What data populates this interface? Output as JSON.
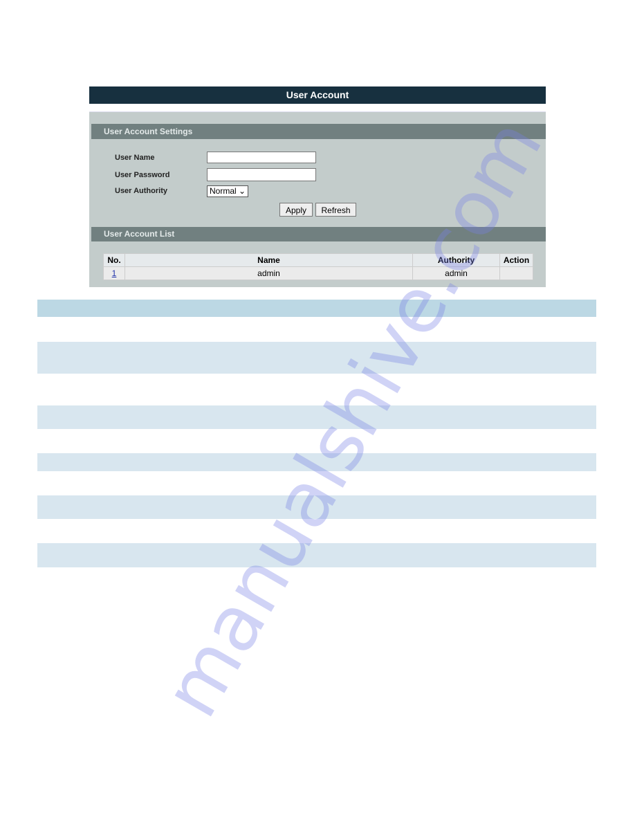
{
  "window": {
    "title": "User Account"
  },
  "settings": {
    "header": "User Account Settings",
    "user_name_label": "User Name",
    "user_name_value": "",
    "user_password_label": "User Password",
    "user_password_value": "",
    "user_authority_label": "User Authority",
    "user_authority_value": "Normal",
    "apply_label": "Apply",
    "refresh_label": "Refresh"
  },
  "list": {
    "header": "User Account List",
    "columns": [
      "No.",
      "Name",
      "Authority",
      "Action"
    ],
    "rows": [
      {
        "no": "1",
        "name": "admin",
        "authority": "admin",
        "action": ""
      }
    ]
  },
  "colors": {
    "titlebar": "#17303f",
    "section_header": "#718080",
    "panel": "#c3cccb",
    "band_header": "#bcd8e4",
    "band_light": "#d8e6ef"
  },
  "watermark": "manualshive.com"
}
